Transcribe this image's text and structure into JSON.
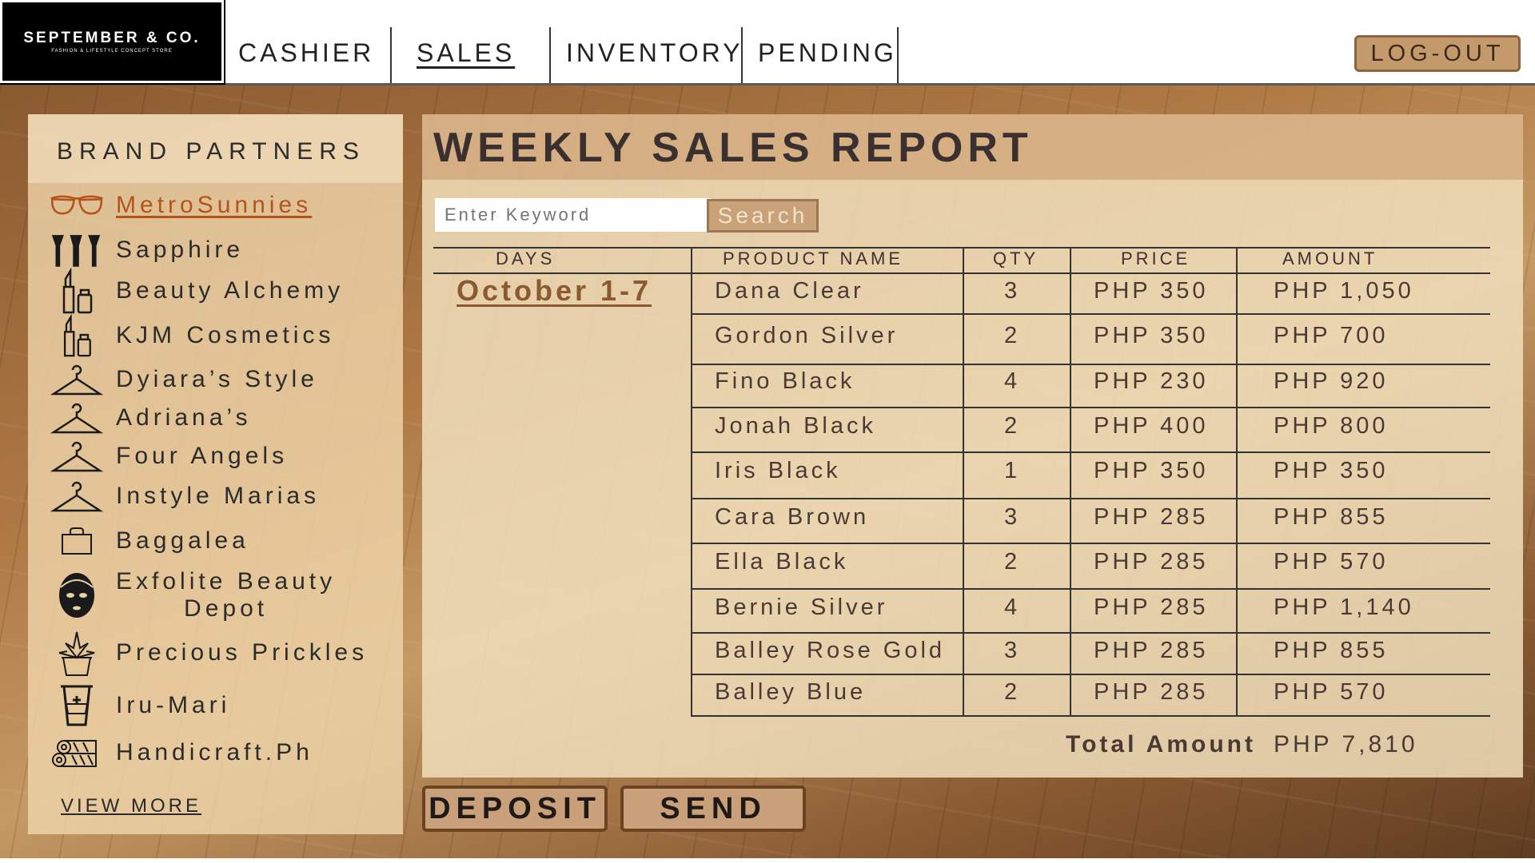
{
  "brand": {
    "name": "SEPTEMBER & CO.",
    "tagline": "FASHION & LIFESTYLE CONCEPT STORE"
  },
  "nav": {
    "cashier": "CASHIER",
    "sales": "SALES",
    "inventory": "INVENTORY",
    "pending": "PENDING",
    "logout": "LOG-OUT"
  },
  "sidebar": {
    "title": "BRAND PARTNERS",
    "items": [
      {
        "label": "MetroSunnies",
        "icon": "sunglasses-icon"
      },
      {
        "label": "Sapphire",
        "icon": "makeup-brushes-icon"
      },
      {
        "label": "Beauty Alchemy",
        "icon": "cosmetics-icon"
      },
      {
        "label": "KJM Cosmetics",
        "icon": "cosmetics-icon"
      },
      {
        "label": "Dyiara’s Style",
        "icon": "hanger-icon"
      },
      {
        "label": "Adriana’s",
        "icon": "hanger-icon"
      },
      {
        "label": "Four Angels",
        "icon": "hanger-icon"
      },
      {
        "label": "Instyle Marias",
        "icon": "hanger-icon"
      },
      {
        "label": "Baggalea",
        "icon": "bag-icon"
      },
      {
        "label": "Exfolite Beauty",
        "label2": "Depot",
        "icon": "face-mask-icon"
      },
      {
        "label": "Precious Prickles",
        "icon": "plant-icon"
      },
      {
        "label": "Iru-Mari",
        "icon": "cup-icon"
      },
      {
        "label": "Handicraft.Ph",
        "icon": "fabric-rolls-icon"
      }
    ],
    "view_more": "VIEW MORE"
  },
  "report": {
    "title": "WEEKLY SALES REPORT",
    "search": {
      "placeholder": "Enter Keyword",
      "button": "Search"
    },
    "columns": {
      "days": "DAYS",
      "product": "PRODUCT NAME",
      "qty": "QTY",
      "price": "PRICE",
      "amount": "AMOUNT"
    },
    "days_value": "October 1-7",
    "rows": [
      {
        "product": "Dana Clear",
        "qty": "3",
        "price": "PHP 350",
        "amount": "PHP 1,050"
      },
      {
        "product": "Gordon Silver",
        "qty": "2",
        "price": "PHP 350",
        "amount": "PHP 700"
      },
      {
        "product": "Fino Black",
        "qty": "4",
        "price": "PHP 230",
        "amount": "PHP 920"
      },
      {
        "product": "Jonah Black",
        "qty": "2",
        "price": "PHP 400",
        "amount": "PHP 800"
      },
      {
        "product": "Iris Black",
        "qty": "1",
        "price": "PHP 350",
        "amount": "PHP 350"
      },
      {
        "product": "Cara Brown",
        "qty": "3",
        "price": "PHP 285",
        "amount": "PHP 855"
      },
      {
        "product": "Ella Black",
        "qty": "2",
        "price": "PHP 285",
        "amount": "PHP 570"
      },
      {
        "product": "Bernie Silver",
        "qty": "4",
        "price": "PHP 285",
        "amount": "PHP 1,140"
      },
      {
        "product": "Balley Rose Gold",
        "qty": "3",
        "price": "PHP 285",
        "amount": "PHP 855"
      },
      {
        "product": "Balley Blue",
        "qty": "2",
        "price": "PHP 285",
        "amount": "PHP 570"
      }
    ],
    "total_label": "Total Amount",
    "total_value": "PHP 7,810"
  },
  "actions": {
    "deposit": "DEPOSIT",
    "send": "SEND"
  },
  "colors": {
    "accent": "#b5531b",
    "button": "#c9a07a",
    "panel": "#f0deba"
  }
}
